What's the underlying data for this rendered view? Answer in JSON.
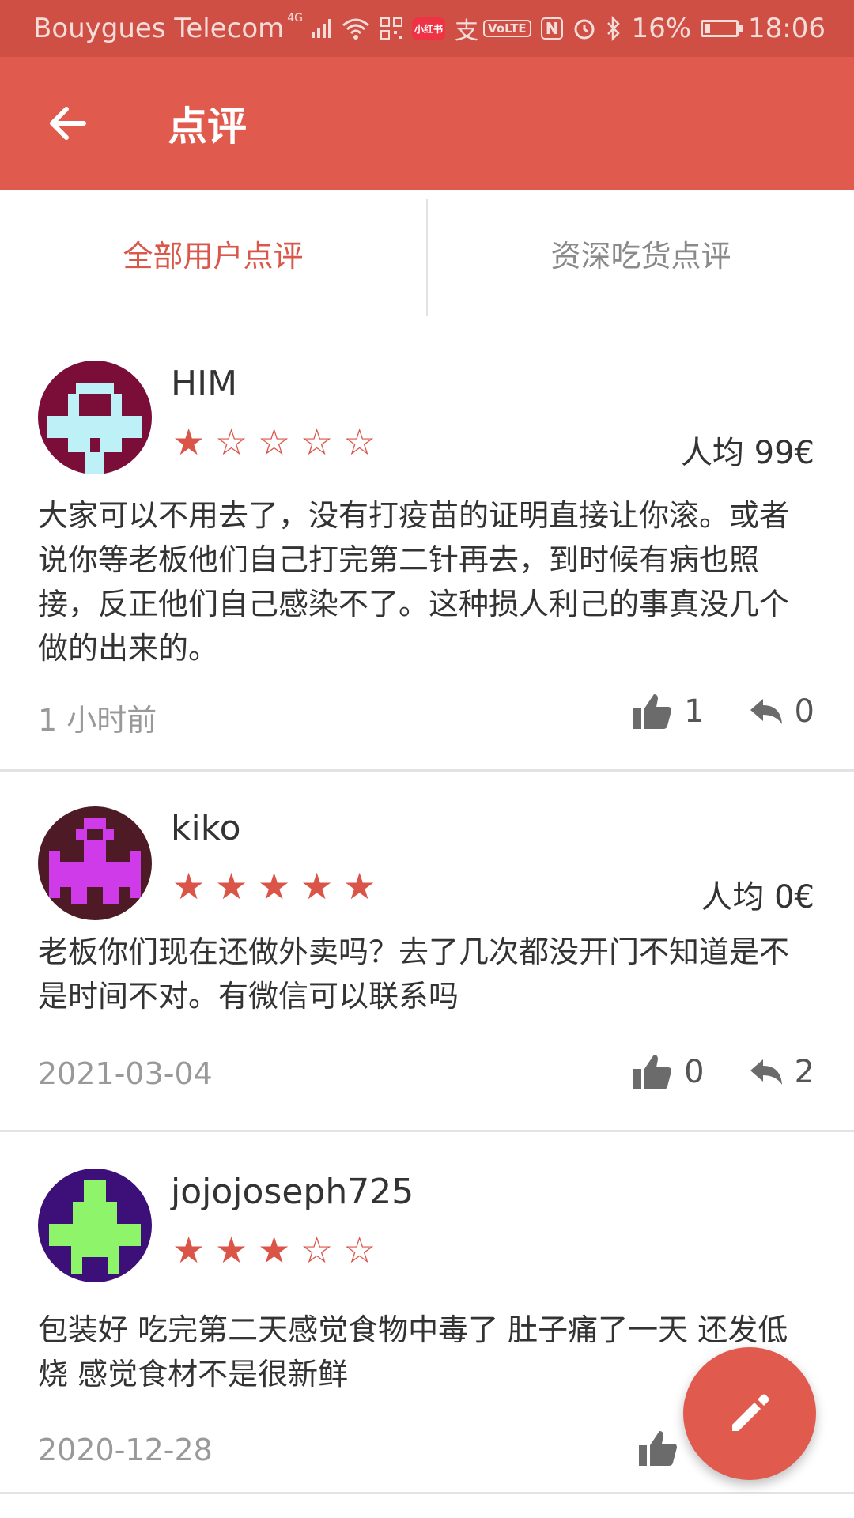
{
  "status_bar": {
    "carrier": "Bouygues Telecom",
    "network_badge": "4G",
    "app_badge": "小红书",
    "pay_badge": "支",
    "volte_label": "VoLTE",
    "nfc_label": "N",
    "battery_percent": "16%",
    "battery_level": 0.16,
    "time": "18:06"
  },
  "app_bar": {
    "back_icon": "arrow-left-icon",
    "title": "点评",
    "color": "#e15a4e"
  },
  "tabs": [
    {
      "label": "全部用户点评",
      "active": true
    },
    {
      "label": "资深吃货点评",
      "active": false
    }
  ],
  "reviews": [
    {
      "username": "HIM",
      "rating": 1,
      "stars": "★☆☆☆☆",
      "price": "人均 99€",
      "content": "大家可以不用去了，没有打疫苗的证明直接让你滚。或者说你等老板他们自己打完第二针再去，到时候有病也照接，反正他们自己感染不了。这种损人利己的事真没几个做的出来的。",
      "time": "1 小时前",
      "likes": "1",
      "replies": "0",
      "avatar_bg": "#7a0e38",
      "avatar_fg": "#bdf1f7"
    },
    {
      "username": "kiko",
      "rating": 5,
      "stars": "★★★★★",
      "price": "人均 0€",
      "content": "老板你们现在还做外卖吗？去了几次都没开门不知道是不是时间不对。有微信可以联系吗",
      "time": "2021-03-04",
      "likes": "0",
      "replies": "2",
      "avatar_bg": "#4e1a26",
      "avatar_fg": "#cf3be8"
    },
    {
      "username": "jojojoseph725",
      "rating": 3,
      "stars": "★★★☆☆",
      "price": "",
      "content": "包装好 吃完第二天感觉食物中毒了 肚子痛了一天 还发低烧 感觉食材不是很新鲜",
      "time": "2020-12-28",
      "likes": "",
      "replies": "",
      "avatar_bg": "#3d0f78",
      "avatar_fg": "#8ef56a"
    }
  ],
  "fab": {
    "icon": "pencil-icon"
  },
  "accent_color": "#db5448"
}
